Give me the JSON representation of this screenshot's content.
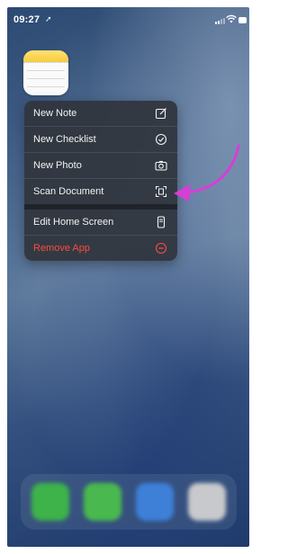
{
  "status_bar": {
    "time": "09:27",
    "location_icon": "location-arrow-icon",
    "signal_icon": "cellular-signal-icon",
    "wifi_icon": "wifi-icon",
    "battery_icon": "battery-icon"
  },
  "home_app": {
    "name": "Notes",
    "icon": "notes-app-icon"
  },
  "quick_actions": [
    {
      "label": "New Note",
      "icon": "compose-icon"
    },
    {
      "label": "New Checklist",
      "icon": "checkmark-circle-icon"
    },
    {
      "label": "New Photo",
      "icon": "camera-icon"
    },
    {
      "label": "Scan Document",
      "icon": "scan-document-icon"
    }
  ],
  "system_actions": [
    {
      "label": "Edit Home Screen",
      "icon": "phone-edit-icon"
    },
    {
      "label": "Remove App",
      "icon": "minus-circle-icon",
      "destructive": true
    }
  ],
  "annotation": {
    "type": "arrow",
    "color": "#d63fd6",
    "target": "Scan Document"
  },
  "dock": {
    "apps": [
      {
        "icon": "phone-app-icon",
        "color": "#3db34a"
      },
      {
        "icon": "messages-app-icon",
        "color": "#49b94f"
      },
      {
        "icon": "safari-app-icon",
        "color": "#3e80d8"
      },
      {
        "icon": "photos-app-icon",
        "color": "#c8c9cc"
      }
    ]
  },
  "colors": {
    "menu_bg": "#30343c",
    "destructive": "#ff4a3f",
    "accent": "#d63fd6"
  }
}
